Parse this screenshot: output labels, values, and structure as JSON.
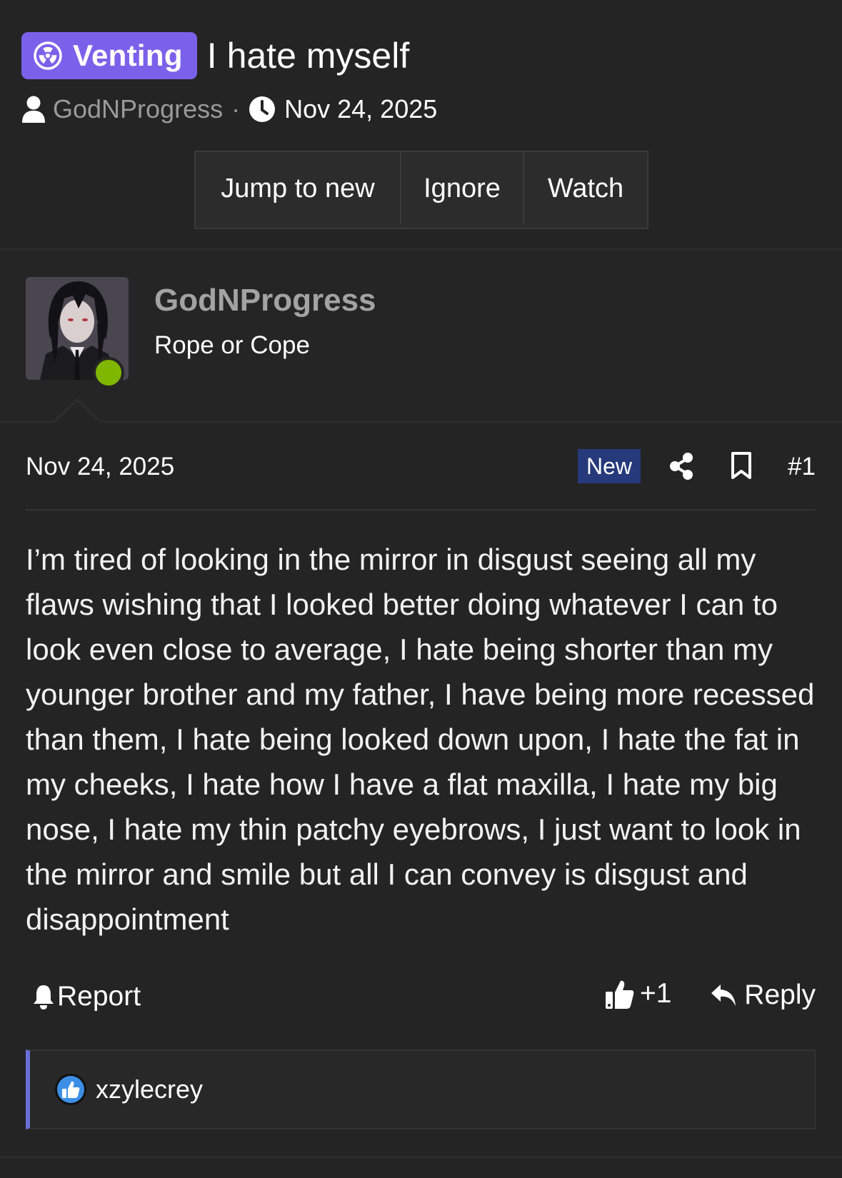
{
  "thread": {
    "prefix_label": "Venting",
    "title": "I hate myself",
    "author": "GodNProgress",
    "meta_separator": "·",
    "date": "Nov 24, 2025",
    "prefix_color": "#7b61ea"
  },
  "thread_actions": {
    "jump_label": "Jump to new",
    "ignore_label": "Ignore",
    "watch_label": "Watch"
  },
  "user": {
    "name": "GodNProgress",
    "title": "Rope or Cope",
    "online": true,
    "online_color": "#7fb600"
  },
  "post": {
    "date": "Nov 24, 2025",
    "new_badge": "New",
    "number": "#1",
    "body": "I’m tired of looking in the mirror in disgust seeing all my flaws wishing that I looked better doing whatever I can to look even close to average, I hate being shorter than my younger brother and my father, I have being more recessed than them, I hate being looked down upon, I hate the fat in my cheeks, I hate how I have a flat maxilla, I hate my big nose, I hate my thin patchy eyebrows, I just want to look in the mirror and smile but all I can convey is disgust and disappointment"
  },
  "post_actions": {
    "report_label": "Report",
    "like_count": "+1",
    "reply_label": "Reply"
  },
  "reactions": {
    "users": "xzylecrey",
    "icon": "like-reaction-icon",
    "accent_color": "#6a70d8"
  },
  "icons": {
    "prefix": "radiation-icon",
    "author": "user-icon",
    "date": "clock-icon",
    "share": "share-icon",
    "bookmark": "bookmark-icon",
    "report": "bell-icon",
    "like": "thumbs-up-icon",
    "reply": "reply-icon"
  }
}
